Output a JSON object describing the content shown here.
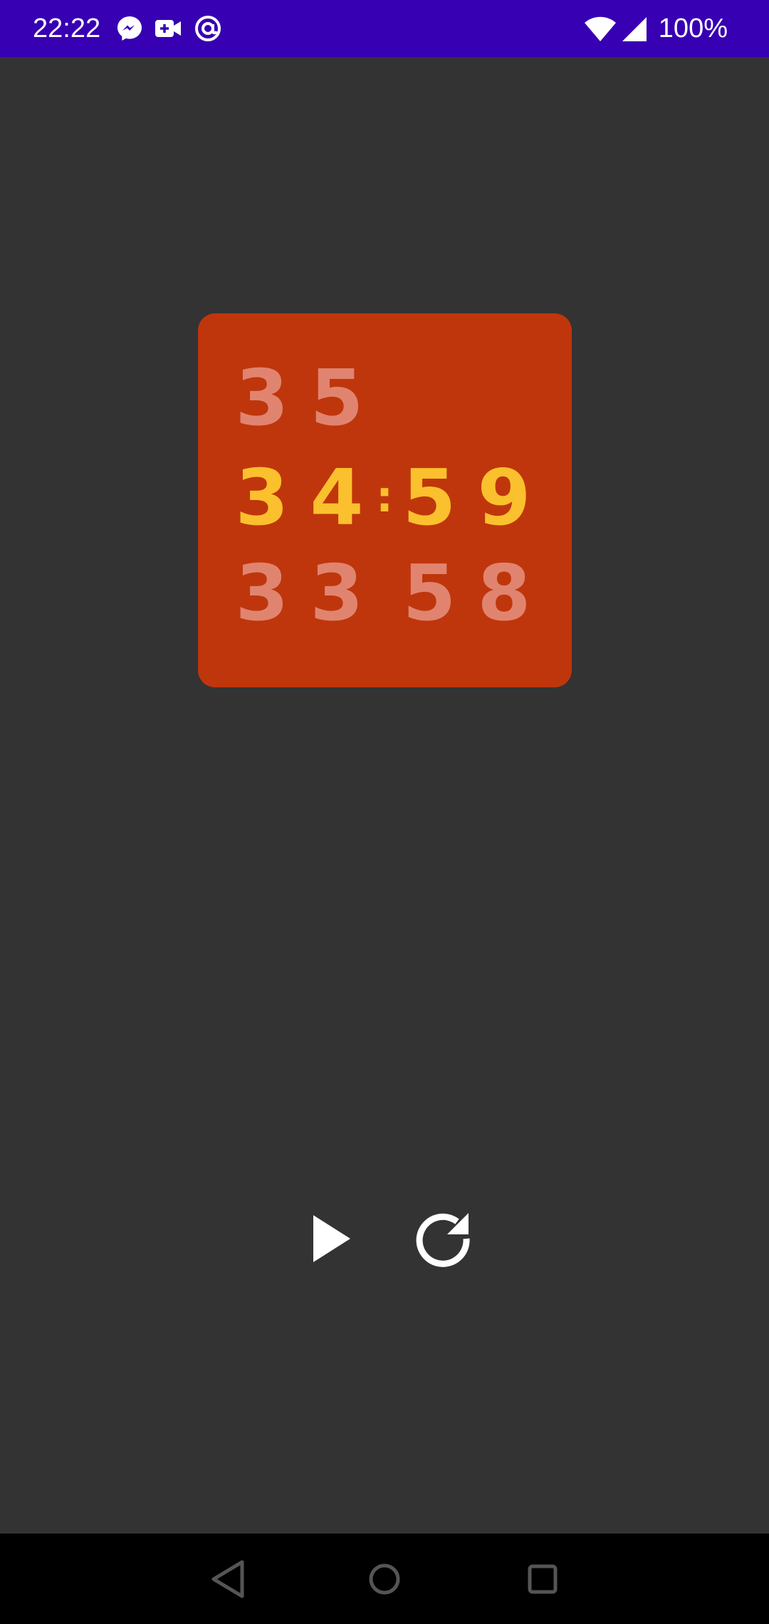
{
  "status_bar": {
    "time": "22:22",
    "battery": "100%",
    "icons": [
      "messenger-icon",
      "video-call-icon",
      "at-sign-icon",
      "wifi-icon",
      "cellular-signal-icon"
    ],
    "background": "#3700b3"
  },
  "clock": {
    "upper_row": [
      "3",
      "5",
      "",
      ""
    ],
    "current_row": [
      "3",
      "4",
      "5",
      "9"
    ],
    "lower_row": [
      "3",
      "3",
      "5",
      "8"
    ],
    "separator": ":",
    "card_color": "#bf360c",
    "active_color": "#fbc02d",
    "faded_color": "#e08470"
  },
  "controls": {
    "play_icon": "play-icon",
    "reset_icon": "refresh-icon"
  },
  "nav_bar": {
    "icons": [
      "back-icon",
      "home-icon",
      "recents-icon"
    ]
  }
}
